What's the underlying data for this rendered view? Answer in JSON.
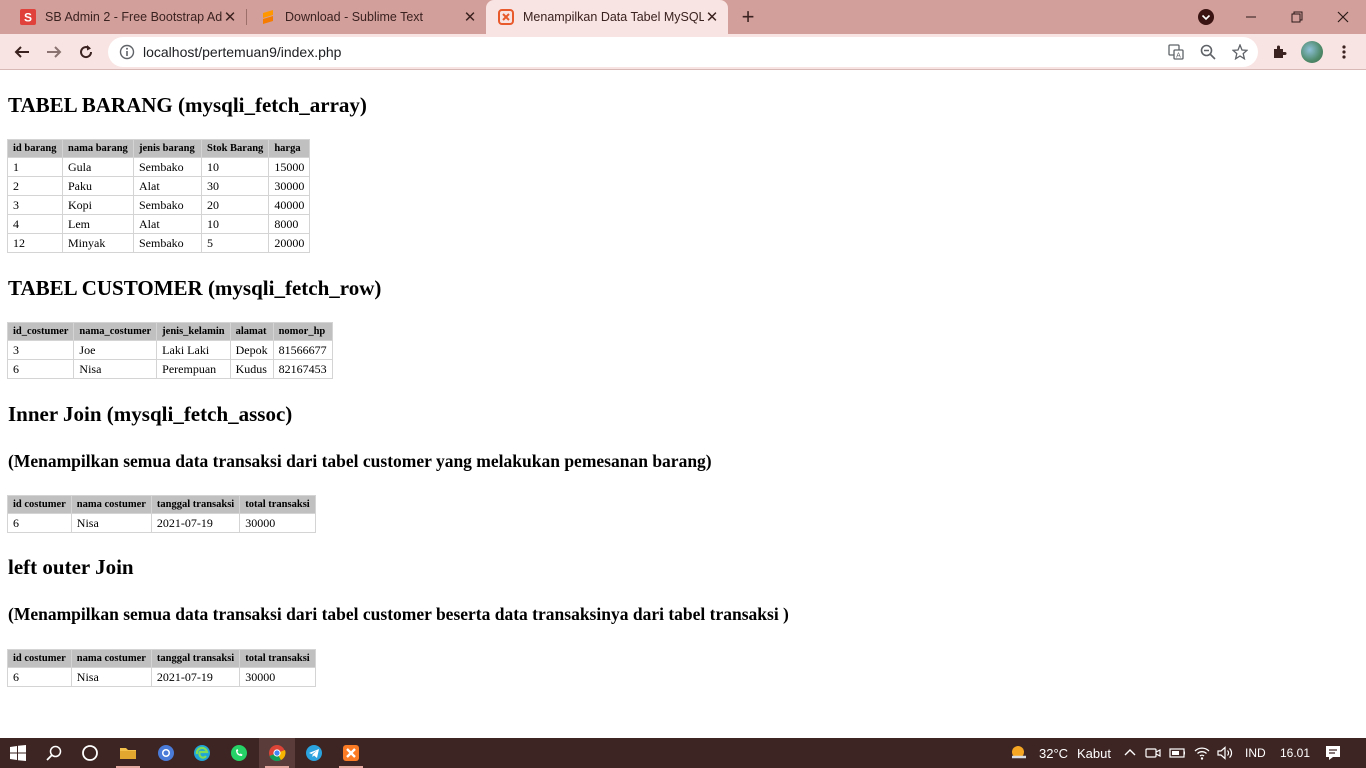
{
  "browser": {
    "tabs": [
      {
        "title": "SB Admin 2 - Free Bootstrap Admin",
        "favicon": "sb-icon",
        "favicon_text": "S",
        "favicon_color": "#e0413a"
      },
      {
        "title": "Download - Sublime Text",
        "favicon": "sublime-icon",
        "favicon_color": "#ff9800"
      },
      {
        "title": "Menampilkan Data Tabel MySQL",
        "favicon": "xampp-icon",
        "favicon_color": "#e8592b"
      }
    ],
    "url": "localhost/pertemuan9/index.php"
  },
  "page": {
    "sections": [
      {
        "heading": "TABEL BARANG (mysqli_fetch_array)",
        "columns": [
          "id barang",
          "nama barang",
          "jenis barang",
          "Stok Barang",
          "harga"
        ],
        "rows": [
          [
            "1",
            "Gula",
            "Sembako",
            "10",
            "15000"
          ],
          [
            "2",
            "Paku",
            "Alat",
            "30",
            "30000"
          ],
          [
            "3",
            "Kopi",
            "Sembako",
            "20",
            "40000"
          ],
          [
            "4",
            "Lem",
            "Alat",
            "10",
            "8000"
          ],
          [
            "12",
            "Minyak",
            "Sembako",
            "5",
            "20000"
          ]
        ]
      },
      {
        "heading": "TABEL CUSTOMER (mysqli_fetch_row)",
        "columns": [
          "id_costumer",
          "nama_costumer",
          "jenis_kelamin",
          "alamat",
          "nomor_hp"
        ],
        "rows": [
          [
            "3",
            "Joe",
            "Laki Laki",
            "Depok",
            "81566677"
          ],
          [
            "6",
            "Nisa",
            "Perempuan",
            "Kudus",
            "82167453"
          ]
        ]
      },
      {
        "heading": "Inner Join (mysqli_fetch_assoc)",
        "subheading": "(Menampilkan semua data transaksi dari tabel customer yang melakukan pemesanan barang)",
        "columns": [
          "id costumer",
          "nama costumer",
          "tanggal transaksi",
          "total transaksi"
        ],
        "rows": [
          [
            "6",
            "Nisa",
            "2021-07-19",
            "30000"
          ]
        ]
      },
      {
        "heading": "left outer Join",
        "subheading": "(Menampilkan semua data transaksi dari tabel customer beserta data transaksinya dari tabel transaksi )",
        "columns": [
          "id costumer",
          "nama costumer",
          "tanggal transaksi",
          "total transaksi"
        ],
        "rows": [
          [
            "6",
            "Nisa",
            "2021-07-19",
            "30000"
          ]
        ]
      }
    ]
  },
  "taskbar": {
    "weather_temp": "32°C",
    "weather_desc": "Kabut",
    "language": "IND",
    "time": "16.01"
  }
}
